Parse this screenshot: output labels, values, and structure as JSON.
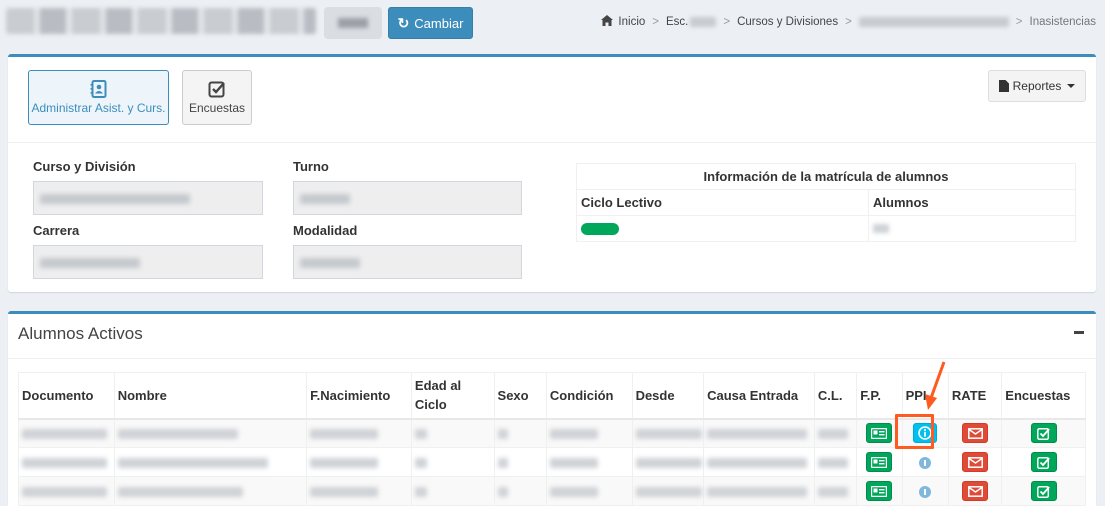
{
  "header": {
    "change_button": "Cambiar",
    "breadcrumb": {
      "home": "Inicio",
      "school": "Esc.",
      "courses": "Cursos y Divisiones",
      "current": "Inasistencias"
    }
  },
  "toolbar": {
    "admin_label": "Administrar Asist. y Curs.",
    "surveys_label": "Encuestas",
    "reports_label": "Reportes"
  },
  "course_info": {
    "course_division_label": "Curso y División",
    "shift_label": "Turno",
    "career_label": "Carrera",
    "modality_label": "Modalidad"
  },
  "enrollment": {
    "title": "Información de la matrícula de alumnos",
    "col_school_year": "Ciclo Lectivo",
    "col_students": "Alumnos"
  },
  "students": {
    "title": "Alumnos Activos",
    "columns": {
      "document": "Documento",
      "name": "Nombre",
      "birth": "F.Nacimiento",
      "age": "Edad al Ciclo",
      "sex": "Sexo",
      "condition": "Condición",
      "since": "Desde",
      "cause": "Causa Entrada",
      "cl": "C.L.",
      "fp": "F.P.",
      "ppi": "PPI.",
      "rate": "RATE",
      "surveys": "Encuestas"
    }
  },
  "colors": {
    "primary": "#3c8dbc",
    "success": "#00a65a",
    "danger": "#dd4b39",
    "info": "#00c0ef",
    "highlight": "#ff5a1f"
  },
  "icons": {
    "change_button": "refresh-icon",
    "home": "home-icon",
    "admin": "address-book-icon",
    "surveys": "check-square-icon",
    "reports": "file-icon",
    "fp": "id-card-icon",
    "ppi": "info-circle-icon",
    "rate": "envelope-icon",
    "survey_row": "check-square-icon"
  }
}
